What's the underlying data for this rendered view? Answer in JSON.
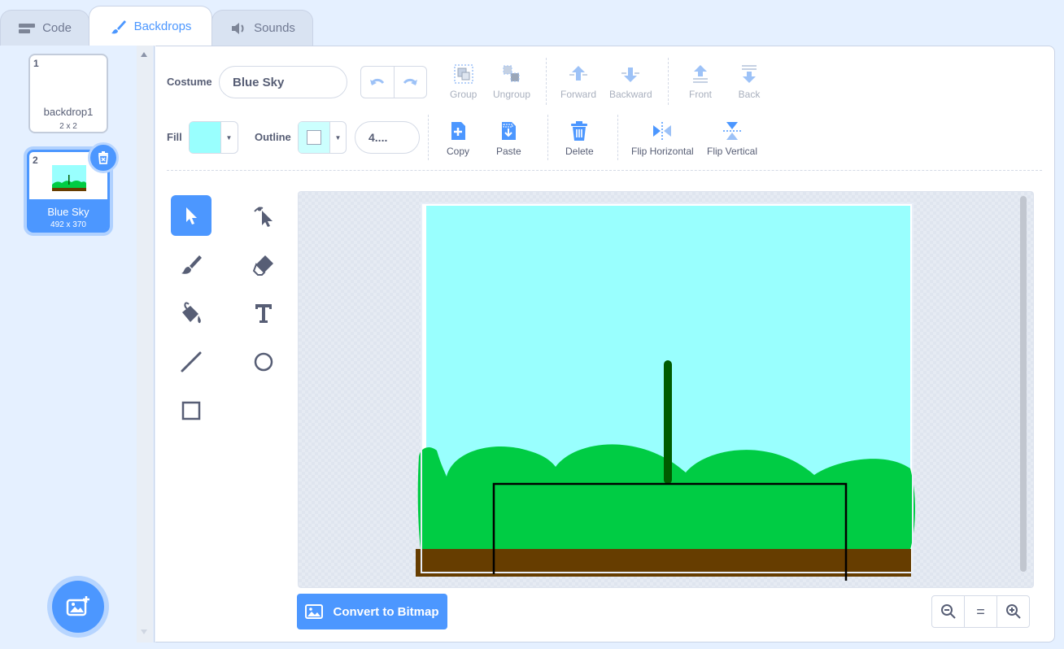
{
  "tabs": [
    {
      "label": "Code",
      "icon": "code-blocks-icon"
    },
    {
      "label": "Backdrops",
      "icon": "paintbrush-icon"
    },
    {
      "label": "Sounds",
      "icon": "speaker-icon"
    }
  ],
  "backdrops": [
    {
      "number": "1",
      "name": "backdrop1",
      "size": "2 x 2"
    },
    {
      "number": "2",
      "name": "Blue Sky",
      "size": "492 x 370"
    }
  ],
  "editor": {
    "costume_label": "Costume",
    "costume_name": "Blue Sky",
    "fill_label": "Fill",
    "outline_label": "Outline",
    "stroke_width": "4....",
    "fill_color": "#99fffe",
    "outline_color": "#ffffff",
    "buttons": {
      "group": "Group",
      "ungroup": "Ungroup",
      "forward": "Forward",
      "backward": "Backward",
      "front": "Front",
      "back": "Back",
      "copy": "Copy",
      "paste": "Paste",
      "delete": "Delete",
      "flip_horizontal": "Flip Horizontal",
      "flip_vertical": "Flip Vertical"
    },
    "convert_button": "Convert to Bitmap",
    "zoom": {
      "out": "−",
      "reset": "=",
      "in": "+"
    }
  },
  "colors": {
    "accent": "#4c97ff",
    "sky": "#99fffe",
    "grass": "#00cc44",
    "ground": "#663d00",
    "stem": "#005c00"
  }
}
